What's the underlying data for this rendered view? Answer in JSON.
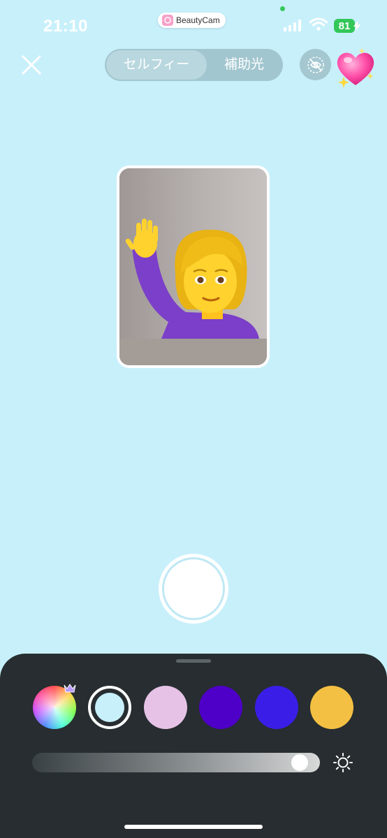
{
  "status_bar": {
    "time": "21:10",
    "app_name": "BeautyCam",
    "battery": "81"
  },
  "top_bar": {
    "mode_tabs": [
      {
        "label": "セルフィー",
        "active": true
      },
      {
        "label": "補助光",
        "active": false
      }
    ]
  },
  "colors": {
    "background": "#c8f0fb",
    "panel": "#272d30",
    "swatches": [
      "color-wheel",
      "#c8f0fb",
      "#e6c3e6",
      "#4e00c8",
      "#3a1ee8",
      "#f4c043"
    ],
    "selected_swatch_index": 1
  },
  "brightness": {
    "level": 0.96
  },
  "icons": [
    "close-icon",
    "eye-off-icon",
    "heart-sparkle-icon",
    "vip-crown-icon",
    "sun-icon"
  ]
}
